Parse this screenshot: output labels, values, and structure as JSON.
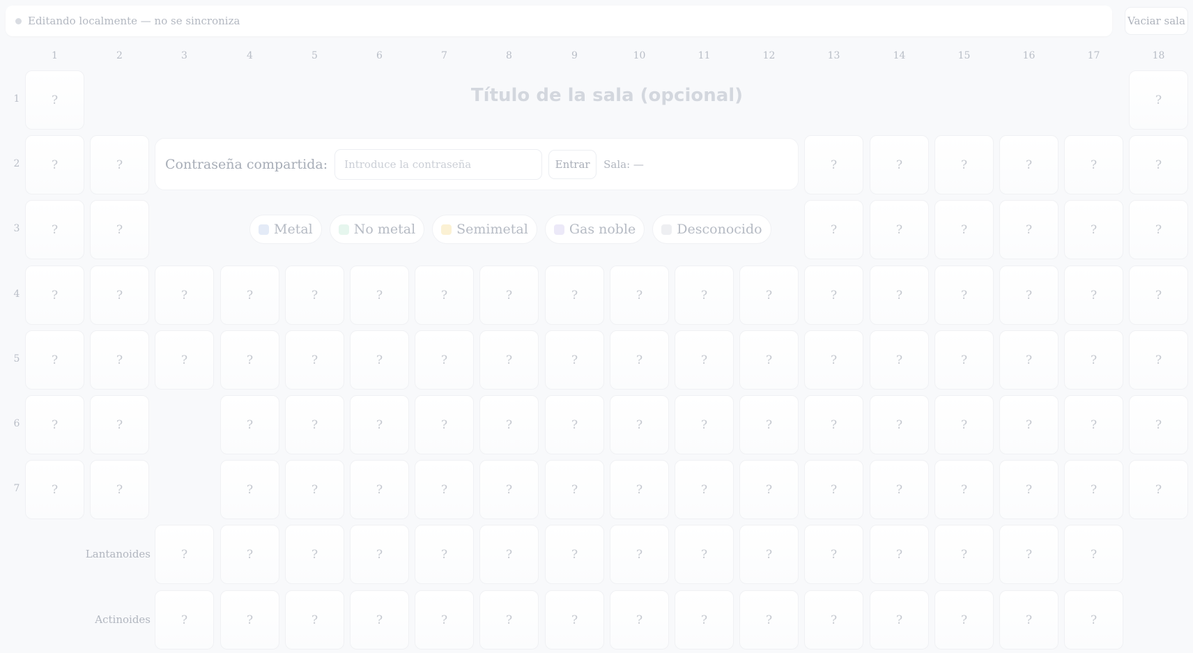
{
  "status": {
    "text": "Editando localmente — no se sincroniza"
  },
  "toolbar": {
    "clear_label": "Vaciar sala"
  },
  "title": {
    "placeholder": "Título de la sala (opcional)"
  },
  "password": {
    "label": "Contraseña compartida:",
    "placeholder": "Introduce la contraseña",
    "enter_label": "Entrar",
    "room_label": "Sala: —"
  },
  "legend": [
    {
      "label": "Metal",
      "color": "#e4ebf7"
    },
    {
      "label": "No metal",
      "color": "#e6f6ee"
    },
    {
      "label": "Semimetal",
      "color": "#fbf1d4"
    },
    {
      "label": "Gas noble",
      "color": "#ece9f8"
    },
    {
      "label": "Desconocido",
      "color": "#eeeff2"
    }
  ],
  "columns": [
    "1",
    "2",
    "3",
    "4",
    "5",
    "6",
    "7",
    "8",
    "9",
    "10",
    "11",
    "12",
    "13",
    "14",
    "15",
    "16",
    "17",
    "18"
  ],
  "rows": [
    "1",
    "2",
    "3",
    "4",
    "5",
    "6",
    "7"
  ],
  "series": {
    "lanthanides": "Lantanoides",
    "actinides": "Actinoides"
  },
  "cell_placeholder": "?"
}
